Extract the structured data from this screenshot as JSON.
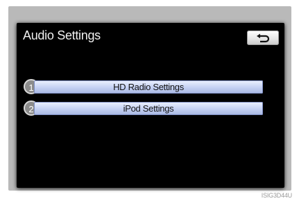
{
  "screen": {
    "title": "Audio Settings",
    "back_button_icon": "return-arrow-icon"
  },
  "menu": {
    "items": [
      {
        "number": "1",
        "label": "HD Radio Settings"
      },
      {
        "number": "2",
        "label": "iPod Settings"
      }
    ]
  },
  "image_id": "ISIG3D44U",
  "colors": {
    "screen_bg": "#000000",
    "bezel": "#b9b9b9",
    "button_blue": "#c7d3f4",
    "title_text": "#f0f0f0"
  }
}
